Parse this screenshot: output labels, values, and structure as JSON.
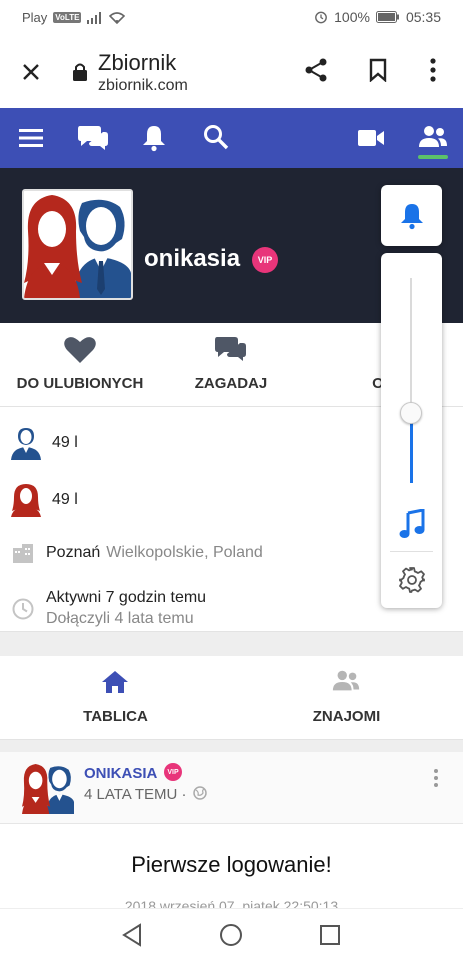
{
  "status_bar": {
    "carrier": "Play",
    "volte": "VoLTE",
    "battery": "100%",
    "time": "05:35"
  },
  "browser": {
    "title": "Zbiornik",
    "url": "zbiornik.com"
  },
  "site_nav": {
    "active": "friends"
  },
  "profile": {
    "username": "onikasia",
    "vip": "VIP",
    "actions": {
      "favorite": "DO ULUBIONYCH",
      "chat": "ZAGADAJ",
      "third": "OP"
    },
    "male_age": "49 l",
    "female_age": "49 l",
    "city": "Poznań",
    "region": "Wielkopolskie, Poland",
    "active": "Aktywni 7 godzin temu",
    "joined": "Dołączyli 4 lata temu"
  },
  "tabs": {
    "wall": "TABLICA",
    "friends": "ZNAJOMI"
  },
  "post": {
    "author": "ONIKASIA",
    "vip": "VIP",
    "time": "4 LATA TEMU ·",
    "title": "Pierwsze logowanie!",
    "date": "2018 wrzesień 07, piątek 22:50:13"
  },
  "audio_popover": {
    "volume_fraction": 0.34
  },
  "colors": {
    "nav_blue": "#3d4fb5",
    "header_dark": "#1f2432",
    "vip_pink": "#e8357a",
    "accent_blue": "#1a73e8",
    "active_green": "#5cc06a"
  }
}
